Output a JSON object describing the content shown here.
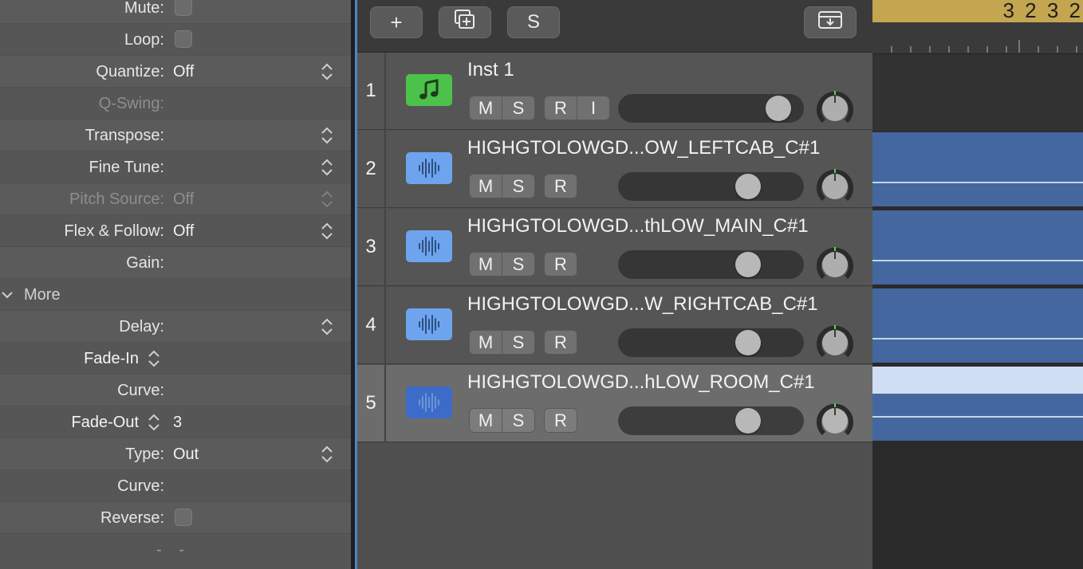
{
  "inspector": {
    "rows": [
      {
        "label": "Mute:",
        "type": "checkbox"
      },
      {
        "label": "Loop:",
        "type": "checkbox"
      },
      {
        "label": "Quantize:",
        "value": "Off",
        "type": "select"
      },
      {
        "label": "Q-Swing:",
        "type": "text",
        "disabled": true
      },
      {
        "label": "Transpose:",
        "type": "select"
      },
      {
        "label": "Fine Tune:",
        "type": "select"
      },
      {
        "label": "Pitch Source:",
        "value": "Off",
        "type": "select",
        "disabled": true
      },
      {
        "label": "Flex & Follow:",
        "value": "Off",
        "type": "select"
      },
      {
        "label": "Gain:",
        "type": "text"
      },
      {
        "label": "More",
        "type": "disclosure"
      },
      {
        "label": "Delay:",
        "type": "select"
      },
      {
        "label": "Fade-In",
        "type": "fade"
      },
      {
        "label": "Curve:",
        "type": "text"
      },
      {
        "label": "Fade-Out",
        "value": "3",
        "type": "fade"
      },
      {
        "label": "Type:",
        "value": "Out",
        "type": "select"
      },
      {
        "label": "Curve:",
        "type": "text"
      },
      {
        "label": "Reverse:",
        "type": "checkbox"
      },
      {
        "label": "- -",
        "type": "dashes"
      }
    ]
  },
  "toolbar": {
    "add_label": "+",
    "duplicate_icon": "duplicate-track-icon",
    "solo_label": "S",
    "download_icon": "download-tray-icon"
  },
  "ruler": {
    "bar_numbers": "3 2 3 2"
  },
  "tracks": [
    {
      "number": "1",
      "name": "Inst 1",
      "kind": "instrument",
      "buttons": [
        "M",
        "S",
        "R",
        "I"
      ],
      "volume": 0.87,
      "selected": false
    },
    {
      "number": "2",
      "name": "HIGHGTOLOWGD...OW_LEFTCAB_C#1",
      "kind": "audio",
      "buttons": [
        "M",
        "S",
        "R"
      ],
      "volume": 0.7,
      "selected": false
    },
    {
      "number": "3",
      "name": "HIGHGTOLOWGD...thLOW_MAIN_C#1",
      "kind": "audio",
      "buttons": [
        "M",
        "S",
        "R"
      ],
      "volume": 0.7,
      "selected": false
    },
    {
      "number": "4",
      "name": "HIGHGTOLOWGD...W_RIGHTCAB_C#1",
      "kind": "audio",
      "buttons": [
        "M",
        "S",
        "R"
      ],
      "volume": 0.7,
      "selected": false
    },
    {
      "number": "5",
      "name": "HIGHGTOLOWGD...hLOW_ROOM_C#1",
      "kind": "audio",
      "buttons": [
        "M",
        "S",
        "R"
      ],
      "volume": 0.7,
      "selected": true
    }
  ],
  "colors": {
    "instrument_icon": "#4cc24a",
    "audio_icon": "#6ea4ee",
    "audio_icon_selected": "#3c6cc8",
    "region": "#44679f",
    "ruler_top": "#c4a650"
  }
}
